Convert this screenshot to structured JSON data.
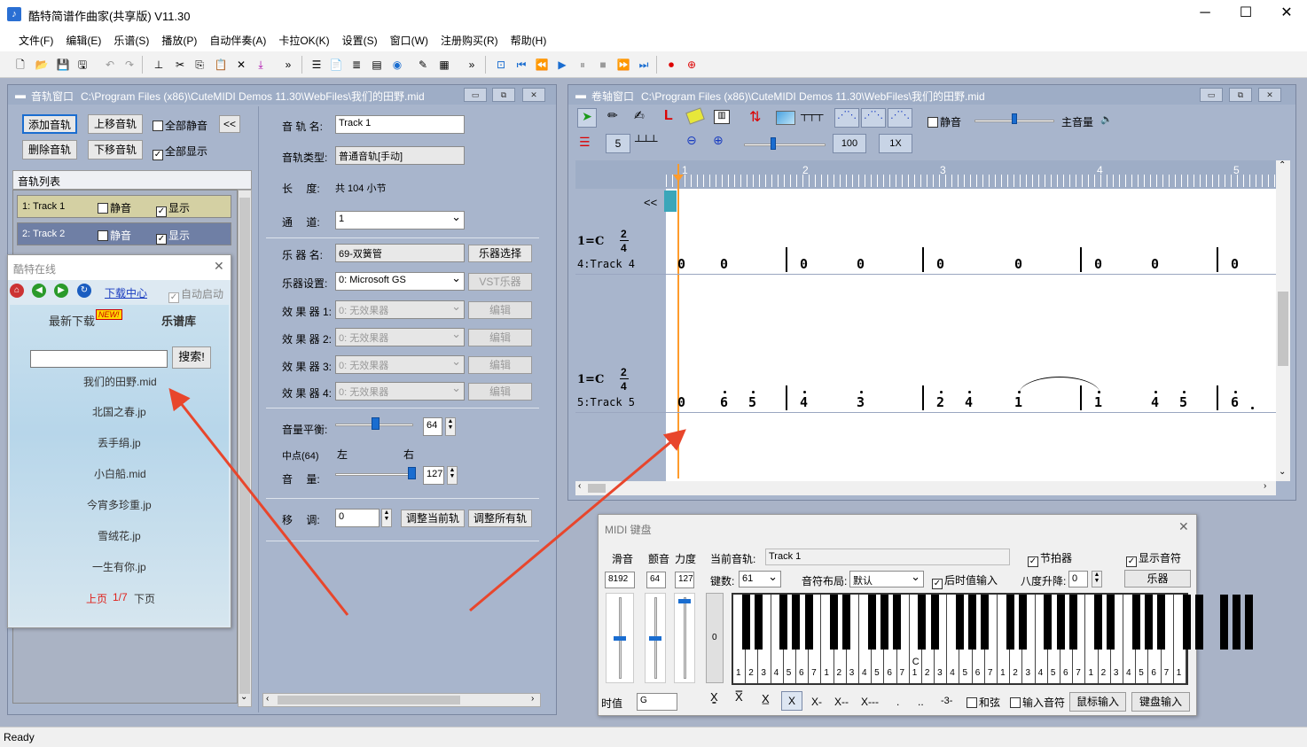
{
  "app": {
    "title": "酷特简谱作曲家(共享版) V11.30"
  },
  "menu": [
    "文件(F)",
    "编辑(E)",
    "乐谱(S)",
    "播放(P)",
    "自动伴奏(A)",
    "卡拉OK(K)",
    "设置(S)",
    "窗口(W)",
    "注册购买(R)",
    "帮助(H)"
  ],
  "track_window": {
    "title": "音轨窗口",
    "path": "C:\\Program Files (x86)\\CuteMIDI Demos 11.30\\WebFiles\\我们的田野.mid",
    "buttons": {
      "add": "添加音轨",
      "up": "上移音轨",
      "del": "删除音轨",
      "down": "下移音轨",
      "collapse": "<<"
    },
    "checks": {
      "mute_all": "全部静音",
      "show_all": "全部显示"
    },
    "list_header": "音轨列表",
    "tracks": [
      {
        "name": "1: Track 1",
        "mute": "静音",
        "show": "显示"
      },
      {
        "name": "2: Track 2",
        "mute": "静音",
        "show": "显示"
      }
    ],
    "props": {
      "name_label": "音 轨 名:",
      "name_value": "Track 1",
      "type_label": "音轨类型:",
      "type_value": "普通音轨[手动]",
      "length_label": "长　 度:",
      "length_value": "共 104 小节",
      "channel_label": "通　 道:",
      "channel_value": "1",
      "instrument_label": "乐 器 名:",
      "instrument_value": "69-双簧管",
      "instrument_btn": "乐器选择",
      "device_label": "乐器设置:",
      "device_value": "0: Microsoft GS",
      "vst_btn": "VST乐器",
      "effects": [
        {
          "label": "效 果 器 1:",
          "value": "0: 无效果器",
          "btn": "编辑"
        },
        {
          "label": "效 果 器 2:",
          "value": "0: 无效果器",
          "btn": "编辑"
        },
        {
          "label": "效 果 器 3:",
          "value": "0: 无效果器",
          "btn": "编辑"
        },
        {
          "label": "效 果 器 4:",
          "value": "0: 无效果器",
          "btn": "编辑"
        }
      ],
      "balance_label": "音量平衡:",
      "balance_value": "64",
      "balance_level": 0.5,
      "center_label": "中点(64)",
      "left_label": "左",
      "right_label": "右",
      "volume_label": "音　 量:",
      "volume_value": "127",
      "volume_level": 1.0,
      "transpose_label": "移　 调:",
      "transpose_value": "0",
      "adjust_current": "调整当前轨",
      "adjust_all": "调整所有轨"
    }
  },
  "online": {
    "title": "酷特在线",
    "download_center": "下载中心",
    "auto_start": "自动启动",
    "tab_latest": "最新下载",
    "new_badge": "NEW!",
    "tab_library": "乐谱库",
    "search_btn": "搜索!",
    "files": [
      "我们的田野.mid",
      "北国之春.jp",
      "丢手绢.jp",
      "小白船.mid",
      "今宵多珍重.jp",
      "雪绒花.jp",
      "一生有你.jp"
    ],
    "pager": {
      "prev": "上页",
      "page": "1/7",
      "next": "下页"
    }
  },
  "roll_window": {
    "title": "卷轴窗口",
    "path": "C:\\Program Files (x86)\\CuteMIDI Demos 11.30\\WebFiles\\我们的田野.mid",
    "mute": "静音",
    "master_volume": "主音量",
    "value_5": "5",
    "zoom_value": "100",
    "speed_value": "1X",
    "ruler": [
      "1",
      "2",
      "3",
      "4",
      "5"
    ],
    "collapse": "<<",
    "staffs": [
      {
        "key": "1=C",
        "time_top": "2",
        "time_bottom": "4",
        "track": "4:Track 4"
      },
      {
        "key": "1=C",
        "time_top": "2",
        "time_bottom": "4",
        "track": "5:Track 5"
      }
    ]
  },
  "midi_kb": {
    "title": "MIDI 键盘",
    "pitch_label": "滑音",
    "vib_label": "颤音",
    "vel_label": "力度",
    "pitch_value": "8192",
    "vib_value": "64",
    "vel_value": "127",
    "pitch_level": 0.5,
    "vib_level": 0.5,
    "vel_level": 1.0,
    "cur_track_label": "当前音轨:",
    "cur_track_value": "Track 1",
    "metronome": "节拍器",
    "show_notes": "显示音符",
    "keys_label": "键数:",
    "keys_value": "61",
    "layout_label": "音符布局:",
    "layout_value": "默认",
    "after_input": "后时值输入",
    "octave_label": "八度升降:",
    "octave_value": "0",
    "instrument_btn": "乐器",
    "side_value": "0",
    "duration_label": "时值",
    "duration_value": "G",
    "chord": "和弦",
    "input_note": "输入音符",
    "mouse_input": "鼠标输入",
    "kb_input": "键盘输入",
    "c_label": "C",
    "digits": [
      "1",
      "2",
      "3",
      "4",
      "5",
      "6",
      "7"
    ]
  },
  "status": "Ready"
}
